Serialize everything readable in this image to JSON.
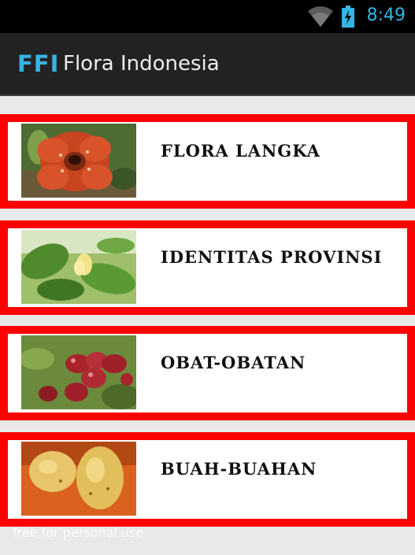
{
  "status_bar": {
    "time": "8:49",
    "wifi_icon": "wifi-icon",
    "battery_icon": "battery-charging-icon",
    "accent_color": "#33b5e5"
  },
  "app_bar": {
    "logo": "FFI",
    "title": "Flora Indonesia",
    "background": "#222222"
  },
  "menu": {
    "items": [
      {
        "label": "FLORA LANGKA",
        "image": "rafflesia-flower-image"
      },
      {
        "label": "IDENTITAS PROVINSI",
        "image": "leaf-flower-image"
      },
      {
        "label": "OBAT-OBATAN",
        "image": "red-berries-image"
      },
      {
        "label": "BUAH-BUAHAN",
        "image": "yellow-fruits-image"
      }
    ],
    "border_color": "#ff0000"
  },
  "watermark": "free for personal use"
}
